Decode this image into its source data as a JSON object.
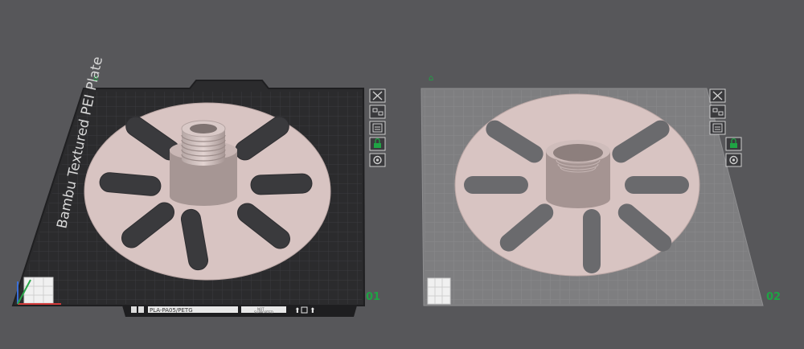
{
  "plate1": {
    "label": "Bambu Textured PEI Plate",
    "number": "01",
    "corner_mark": "⌂",
    "status_bar": {
      "filament_text": "PLA-PA05/PETG",
      "info_line1": "NOT",
      "info_line2": "SUPPORTED"
    }
  },
  "plate2": {
    "number": "02",
    "corner_mark": "⌂"
  },
  "toolbar_icons": [
    "close-icon",
    "arrange-icon",
    "orient-icon",
    "lock-icon",
    "settings-icon"
  ],
  "colors": {
    "background": "#57575a",
    "plate_dark": "#2b2b2d",
    "plate_light": "#7e7e80",
    "part_pink": "#d8c4c2",
    "plate_number": "#1fa344",
    "axis_x": "#d23a3a",
    "axis_y": "#2aa54a",
    "axis_z": "#3a6fd8"
  }
}
